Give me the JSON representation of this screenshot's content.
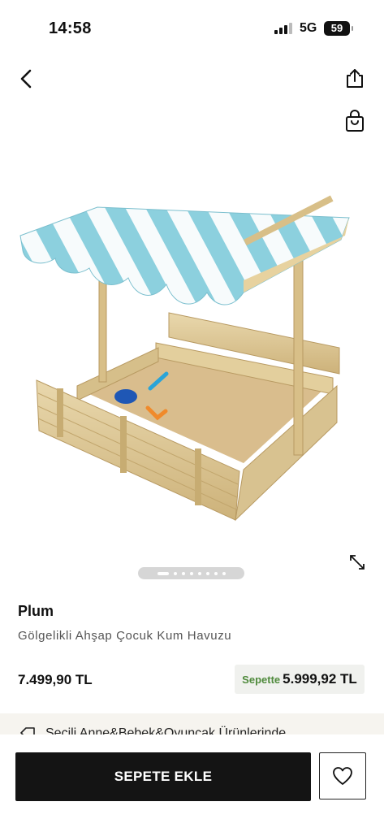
{
  "status_bar": {
    "time": "14:58",
    "network": "5G",
    "battery": "59"
  },
  "nav": {
    "back_icon": "chevron-left-icon",
    "share_icon": "share-icon",
    "bag_icon": "shopping-bag-icon"
  },
  "gallery": {
    "image_subject": "wooden sandbox with striped canopy",
    "dot_count": 8,
    "active_index": 0
  },
  "product": {
    "brand": "Plum",
    "name": "Gölgelikli Ahşap Çocuk Kum Havuzu",
    "price": "7.499,90 TL",
    "cart_price_label": "Sepette",
    "cart_price_value": "5.999,92 TL"
  },
  "promo": {
    "text": "Seçili Anne&Bebek&Oyuncak Ürünlerinde"
  },
  "actions": {
    "add_to_cart_label": "SEPETE EKLE",
    "wishlist_icon": "heart-icon"
  },
  "colors": {
    "primary_button": "#141414",
    "cart_price_accent": "#4f8a3c",
    "canopy_stripe": "#8cd0de"
  }
}
